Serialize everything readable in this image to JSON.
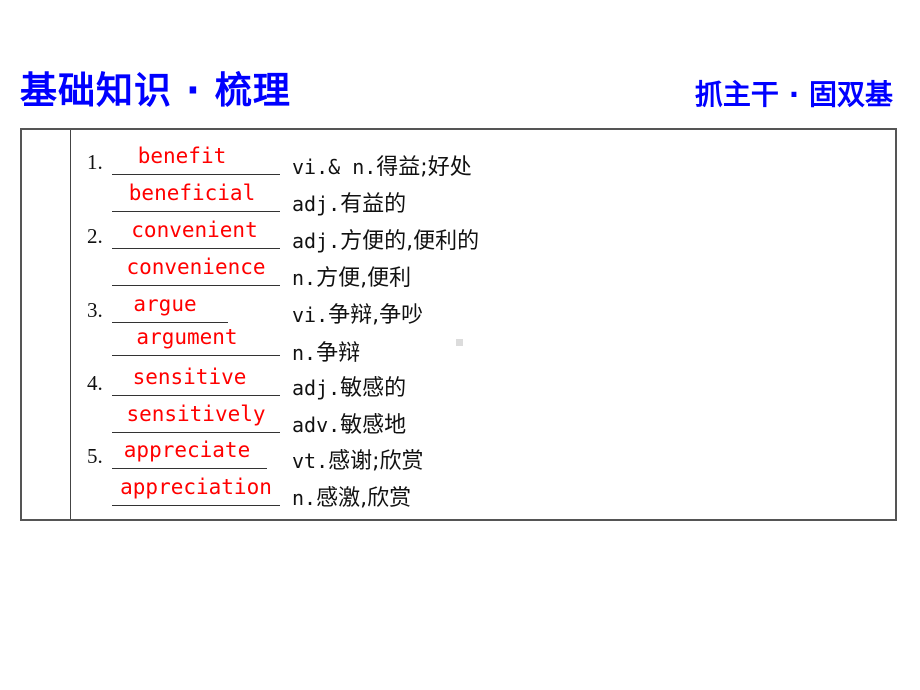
{
  "header": {
    "title_left": "基础知识 · 梳理",
    "title_right": "抓主干 · 固双基"
  },
  "colors": {
    "title": "#0000ff",
    "answer": "#ff0000",
    "text": "#111111"
  },
  "items": [
    {
      "number": "1.",
      "answer": "benefit",
      "pos": "vi.& n.",
      "meaning": "得益;好处"
    },
    {
      "number": "",
      "answer": "beneficial",
      "pos": "adj.",
      "meaning": "有益的"
    },
    {
      "number": "2.",
      "answer": "convenient",
      "pos": "adj.",
      "meaning": "方便的,便利的"
    },
    {
      "number": "",
      "answer": "convenience",
      "pos": "n.",
      "meaning": "方便,便利"
    },
    {
      "number": "3.",
      "answer": "argue",
      "pos": "vi.",
      "meaning": "争辩,争吵"
    },
    {
      "number": "",
      "answer": "argument",
      "pos": "n.",
      "meaning": "争辩"
    },
    {
      "number": "4.",
      "answer": "sensitive",
      "pos": "adj.",
      "meaning": "敏感的"
    },
    {
      "number": "",
      "answer": "sensitively",
      "pos": "adv.",
      "meaning": "敏感地"
    },
    {
      "number": "5.",
      "answer": "appreciate",
      "pos": "vt.",
      "meaning": "感谢;欣赏"
    },
    {
      "number": "",
      "answer": "appreciation",
      "pos": "n.",
      "meaning": "感激,欣赏"
    }
  ]
}
